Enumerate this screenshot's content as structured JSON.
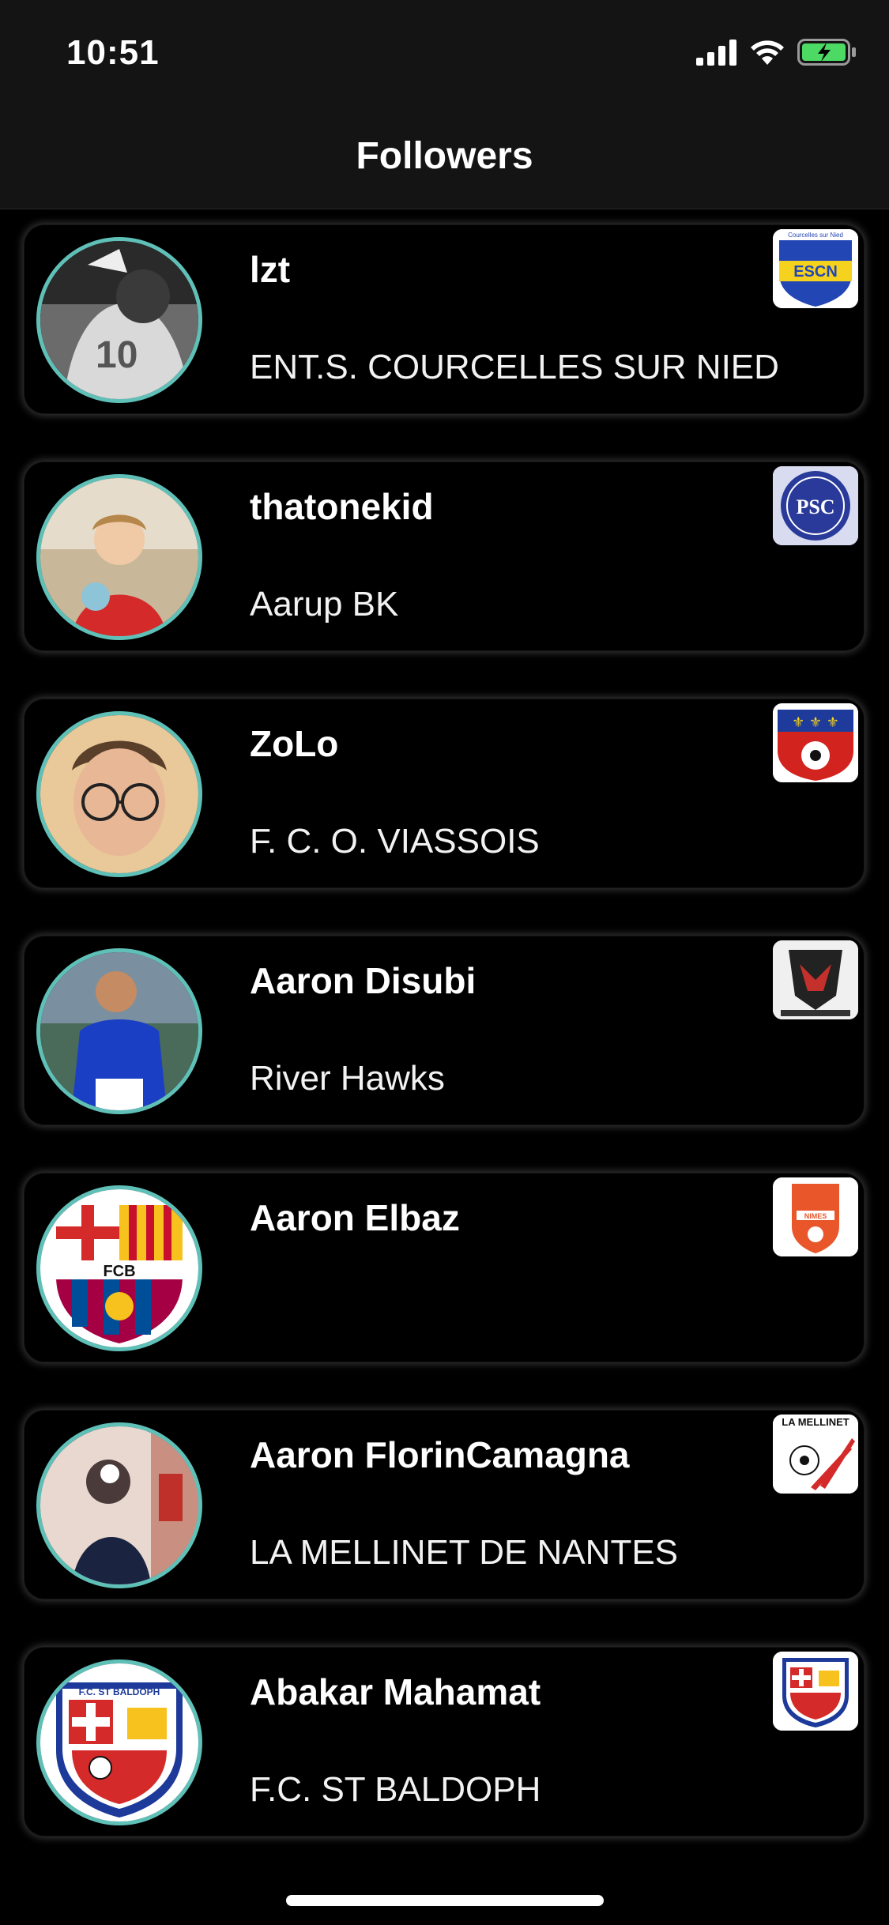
{
  "status_bar": {
    "time": "10:51"
  },
  "navbar": {
    "title": "Followers"
  },
  "followers": [
    {
      "name": "lzt",
      "club": "ENT.S. COURCELLES SUR NIED",
      "avatar": "player-photo-bw",
      "badge": "escn-badge"
    },
    {
      "name": "thatonekid",
      "club": "Aarup BK",
      "avatar": "kid-photo",
      "badge": "psc-badge"
    },
    {
      "name": "ZoLo",
      "club": "F. C. O. VIASSOIS",
      "avatar": "selfie-glasses-photo",
      "badge": "fco-badge"
    },
    {
      "name": "Aaron Disubi",
      "club": "River Hawks",
      "avatar": "blue-kit-player-photo",
      "badge": "riverhawks-badge"
    },
    {
      "name": "Aaron Elbaz",
      "club": "",
      "avatar": "fcb-crest",
      "badge": "nimes-badge"
    },
    {
      "name": "Aaron FlorinCamagna",
      "club": "LA MELLINET DE NANTES",
      "avatar": "mirror-selfie-photo",
      "badge": "la-mellinet-badge"
    },
    {
      "name": "Abakar Mahamat",
      "club": "F.C. ST BALDOPH",
      "avatar": "fc-st-baldoph-crest",
      "badge": "fc-st-baldoph-badge"
    }
  ],
  "badge_texts": {
    "escn": "ESCN",
    "escn_top": "Courcelles sur Nied",
    "psc": "PSC",
    "mellinet": "LA MELLINET",
    "baldoph": "F.C. ST BALDOPH",
    "fcb": "FCB",
    "nimes": "NIMES"
  },
  "colors": {
    "accent_ring": "#5fc0b8",
    "background": "#000000",
    "bar": "#141414",
    "battery": "#4cd964"
  }
}
